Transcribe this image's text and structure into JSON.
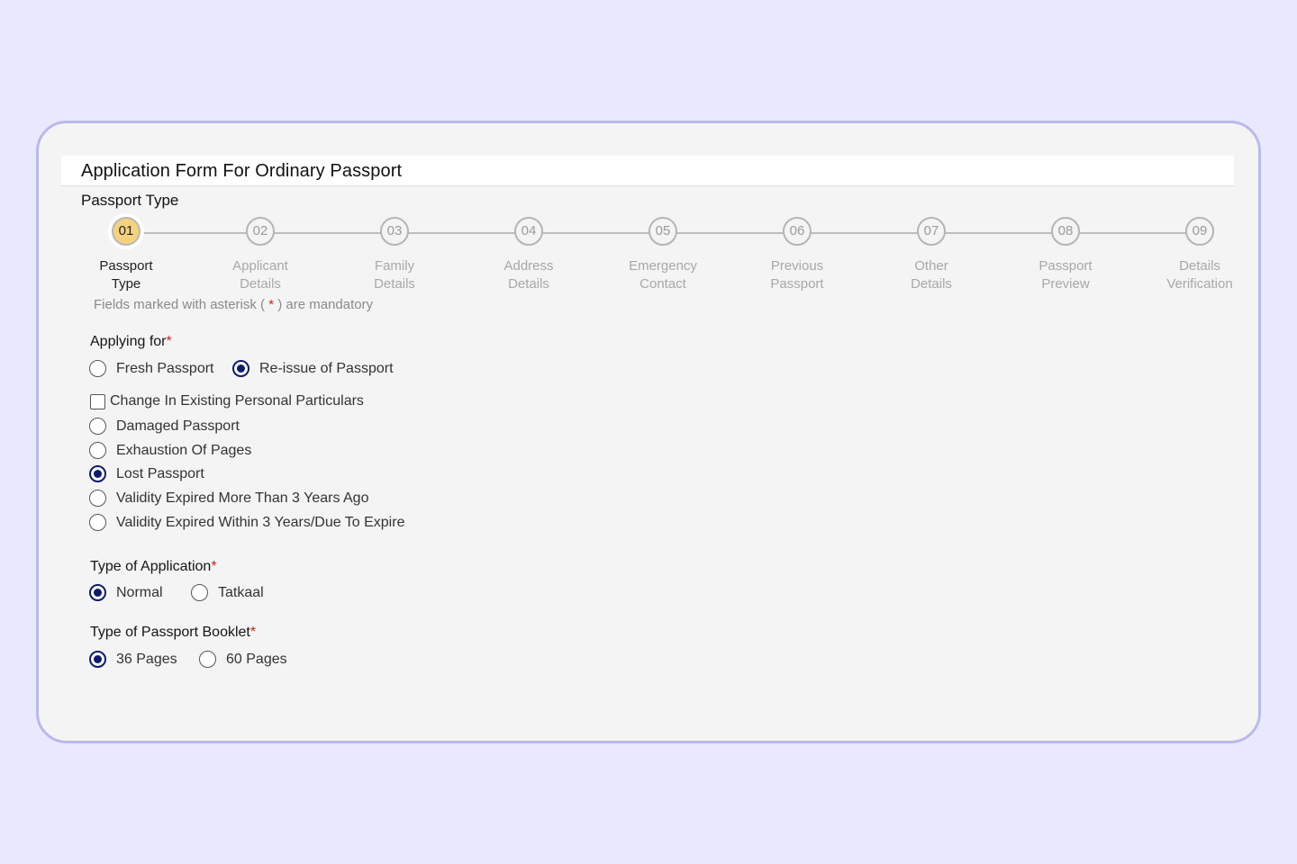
{
  "form": {
    "title": "Application Form For Ordinary Passport",
    "section_title": "Passport Type"
  },
  "steps": [
    {
      "number": "01",
      "line1": "Passport",
      "line2": "Type",
      "active": true
    },
    {
      "number": "02",
      "line1": "Applicant",
      "line2": "Details"
    },
    {
      "number": "03",
      "line1": "Family",
      "line2": "Details"
    },
    {
      "number": "04",
      "line1": "Address",
      "line2": "Details"
    },
    {
      "number": "05",
      "line1": "Emergency",
      "line2": "Contact"
    },
    {
      "number": "06",
      "line1": "Previous",
      "line2": "Passport"
    },
    {
      "number": "07",
      "line1": "Other",
      "line2": "Details"
    },
    {
      "number": "08",
      "line1": "Passport",
      "line2": "Preview"
    },
    {
      "number": "09",
      "line1": "Details",
      "line2": "Verification"
    }
  ],
  "mandatory_note": {
    "prefix": "Fields marked with asterisk ( ",
    "asterisk": "*",
    "suffix": " ) are mandatory"
  },
  "applying_for": {
    "label": "Applying for",
    "required_mark": "*",
    "options": [
      {
        "label": "Fresh Passport",
        "selected": false
      },
      {
        "label": "Re-issue of Passport",
        "selected": true
      }
    ],
    "change_particulars_label": "Change In Existing Personal Particulars",
    "change_particulars_checked": false,
    "reasons": [
      {
        "label": "Damaged Passport",
        "selected": false
      },
      {
        "label": "Exhaustion Of Pages",
        "selected": false
      },
      {
        "label": "Lost Passport",
        "selected": true
      },
      {
        "label": "Validity Expired More Than 3 Years Ago",
        "selected": false
      },
      {
        "label": "Validity Expired Within 3 Years/Due To Expire",
        "selected": false
      }
    ]
  },
  "application_type": {
    "label": "Type of Application",
    "required_mark": "*",
    "options": [
      {
        "label": "Normal",
        "selected": true
      },
      {
        "label": "Tatkaal",
        "selected": false
      }
    ]
  },
  "booklet_type": {
    "label": "Type of Passport Booklet",
    "required_mark": "*",
    "options": [
      {
        "label": "36 Pages",
        "selected": true
      },
      {
        "label": "60 Pages",
        "selected": false
      }
    ]
  },
  "colors": {
    "accent": "#0d1a6e",
    "active_step": "#f5d27e",
    "required": "#d21f1f",
    "page_bg": "#e9e9fd",
    "card_border": "#b9b9ec"
  }
}
